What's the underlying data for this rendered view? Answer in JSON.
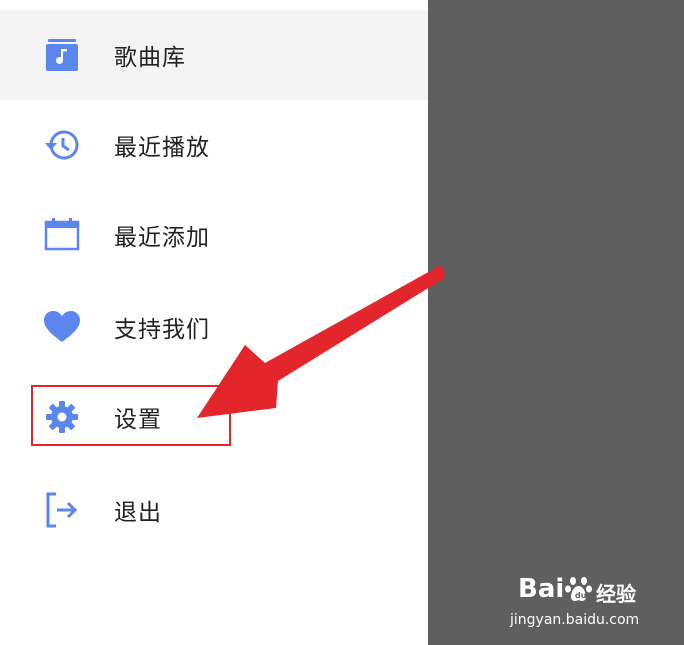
{
  "menu": {
    "items": [
      {
        "id": "library",
        "label": "歌曲库",
        "icon": "music-library-icon",
        "active": true
      },
      {
        "id": "recent-played",
        "label": "最近播放",
        "icon": "history-icon",
        "active": false
      },
      {
        "id": "recent-added",
        "label": "最近添加",
        "icon": "calendar-icon",
        "active": false
      },
      {
        "id": "support",
        "label": "支持我们",
        "icon": "heart-icon",
        "active": false
      },
      {
        "id": "settings",
        "label": "设置",
        "icon": "gear-icon",
        "active": false
      },
      {
        "id": "logout",
        "label": "退出",
        "icon": "logout-icon",
        "active": false
      }
    ]
  },
  "colors": {
    "icon_blue": "#5b86ee",
    "annotation_red": "#e3262b",
    "overlay_gray": "#5f5f5f"
  },
  "watermark": {
    "logo": "Bai",
    "logo_suffix": "经验",
    "url": "jingyan.baidu.com"
  }
}
